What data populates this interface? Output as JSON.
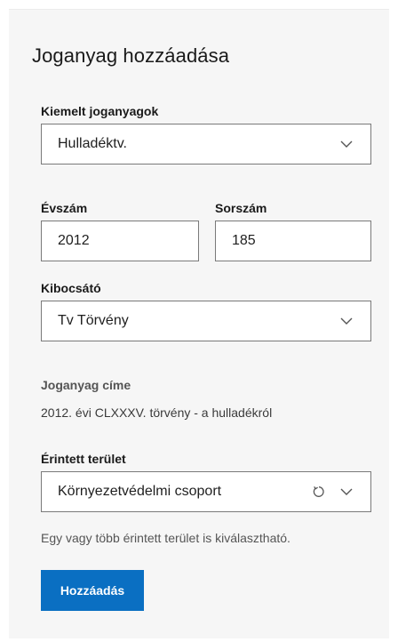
{
  "form": {
    "title": "Joganyag hozzáadása",
    "featured": {
      "label": "Kiemelt joganyagok",
      "value": "Hulladéktv."
    },
    "year": {
      "label": "Évszám",
      "value": "2012"
    },
    "number": {
      "label": "Sorszám",
      "value": "185"
    },
    "issuer": {
      "label": "Kibocsátó",
      "value": "Tv Törvény"
    },
    "law_title": {
      "label": "Joganyag címe",
      "value": "2012. évi CLXXXV. törvény - a hulladékról"
    },
    "area": {
      "label": "Érintett terület",
      "value": "Környezetvédelmi csoport",
      "helper": "Egy vagy több érintett terület is kiválasztható."
    },
    "submit_label": "Hozzáadás"
  },
  "icons": {
    "dropdown": "chevron-down-icon",
    "reset": "reset-icon"
  },
  "colors": {
    "primary": "#0a6fc2",
    "panel_bg": "#f6f6f6",
    "border": "#7a7a7a"
  }
}
